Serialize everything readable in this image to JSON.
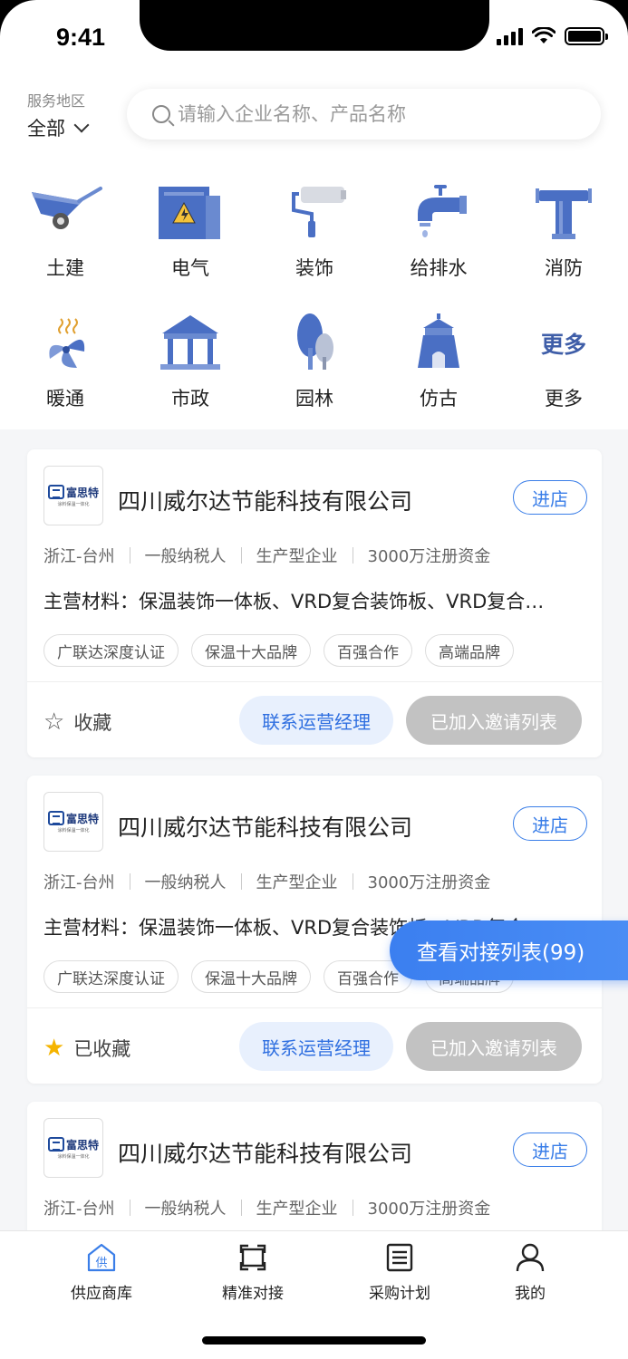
{
  "status_bar": {
    "time": "9:41"
  },
  "header": {
    "region_label": "服务地区",
    "region_value": "全部",
    "search_placeholder": "请输入企业名称、产品名称"
  },
  "categories": [
    {
      "label": "土建",
      "icon": "wheelbarrow-icon"
    },
    {
      "label": "电气",
      "icon": "electric-box-icon"
    },
    {
      "label": "装饰",
      "icon": "paint-roller-icon"
    },
    {
      "label": "给排水",
      "icon": "faucet-icon"
    },
    {
      "label": "消防",
      "icon": "fire-hydrant-pipe-icon"
    },
    {
      "label": "暖通",
      "icon": "fan-icon"
    },
    {
      "label": "市政",
      "icon": "pavilion-icon"
    },
    {
      "label": "园林",
      "icon": "trees-icon"
    },
    {
      "label": "仿古",
      "icon": "ancient-gate-icon"
    },
    {
      "label": "更多",
      "icon": "more-text-icon",
      "icon_text": "更多"
    }
  ],
  "cards": [
    {
      "logo_name": "富思特",
      "logo_sub": "涂料保温一体化",
      "company": "四川威尔达节能科技有限公司",
      "enter_label": "进店",
      "meta": [
        "浙江-台州",
        "一般纳税人",
        "生产型企业",
        "3000万注册资金"
      ],
      "materials": "主营材料：保温装饰一体板、VRD复合装饰板、VRD复合…",
      "tags": [
        "广联达深度认证",
        "保温十大品牌",
        "百强合作",
        "高端品牌"
      ],
      "fav_label": "收藏",
      "favorited": false,
      "contact_label": "联系运营经理",
      "invited_label": "已加入邀请列表"
    },
    {
      "logo_name": "富思特",
      "logo_sub": "涂料保温一体化",
      "company": "四川威尔达节能科技有限公司",
      "enter_label": "进店",
      "meta": [
        "浙江-台州",
        "一般纳税人",
        "生产型企业",
        "3000万注册资金"
      ],
      "materials": "主营材料：保温装饰一体板、VRD复合装饰板、VRD复合…",
      "tags": [
        "广联达深度认证",
        "保温十大品牌",
        "百强合作",
        "高端品牌"
      ],
      "fav_label": "已收藏",
      "favorited": true,
      "contact_label": "联系运营经理",
      "invited_label": "已加入邀请列表"
    },
    {
      "logo_name": "富思特",
      "logo_sub": "涂料保温一体化",
      "company": "四川威尔达节能科技有限公司",
      "enter_label": "进店",
      "meta": [
        "浙江-台州",
        "一般纳税人",
        "生产型企业",
        "3000万注册资金"
      ]
    }
  ],
  "float_button": {
    "label": "查看对接列表(99)"
  },
  "tabbar": [
    {
      "label": "供应商库",
      "icon": "supplier-icon",
      "active": true,
      "icon_char": "供"
    },
    {
      "label": "精准对接",
      "icon": "match-icon",
      "active": false
    },
    {
      "label": "采购计划",
      "icon": "list-icon",
      "active": false
    },
    {
      "label": "我的",
      "icon": "user-icon",
      "active": false
    }
  ],
  "colors": {
    "accent": "#3a7ee8",
    "icon_blue": "#4a6fc4",
    "star_active": "#f5b400",
    "disabled_button": "#c2c2c2"
  }
}
